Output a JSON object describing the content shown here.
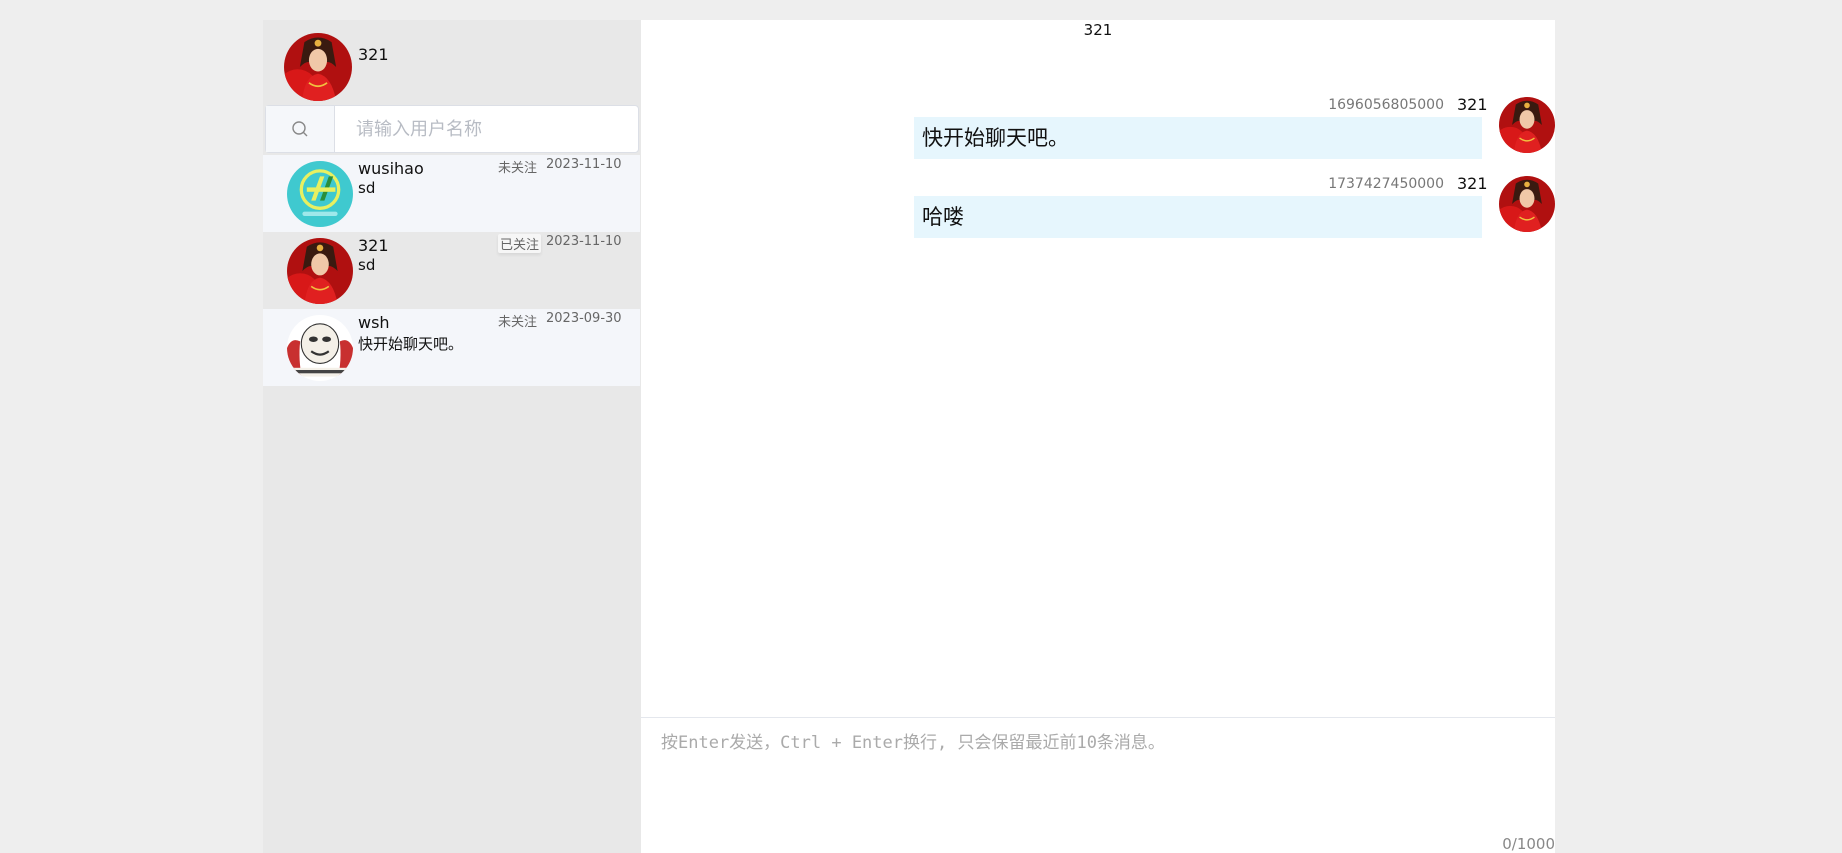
{
  "current_user": {
    "name": "321"
  },
  "search": {
    "placeholder": "请输入用户名称",
    "value": ""
  },
  "contacts": [
    {
      "name": "wusihao",
      "last_message": "sd",
      "follow_status": "未关注",
      "date": "2023-11-10",
      "avatar": "teal-logo"
    },
    {
      "name": "321",
      "last_message": "sd",
      "follow_status": "已关注",
      "date": "2023-11-10",
      "avatar": "red-portrait"
    },
    {
      "name": "wsh",
      "last_message": "快开始聊天吧。",
      "follow_status": "未关注",
      "date": "2023-09-30",
      "avatar": "meme-face"
    }
  ],
  "chat": {
    "title": "321",
    "messages": [
      {
        "timestamp": "1696056805000",
        "user": "321",
        "text": "快开始聊天吧。"
      },
      {
        "timestamp": "1737427450000",
        "user": "321",
        "text": "哈喽"
      }
    ],
    "composer": {
      "placeholder": "按Enter发送，Ctrl + Enter换行, 只会保留最近前10条消息。",
      "counter": "0/1000"
    }
  },
  "colors": {
    "page_bg": "#eeeeee",
    "sidebar_bg": "#e8e8e8",
    "contact_highlight": "#f4f6fa",
    "bubble_bg": "#e6f6fd"
  },
  "icons": {
    "search": "search-icon"
  }
}
